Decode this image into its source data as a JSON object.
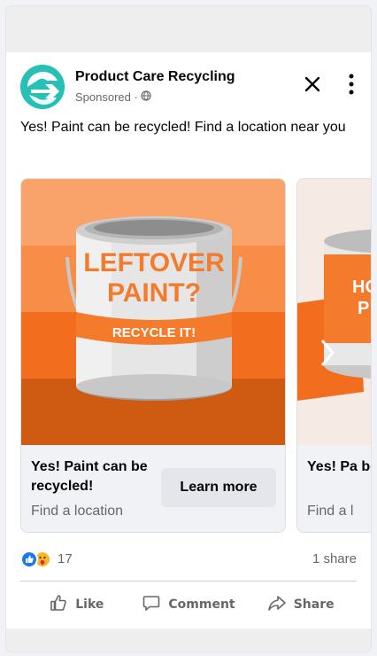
{
  "post": {
    "page_name": "Product Care Recycling",
    "sponsored_label": "Sponsored ·",
    "caption": "Yes! Paint can be recycled! Find a location near you"
  },
  "carousel": [
    {
      "image_text_1": "LEFTOVER",
      "image_text_2": "PAINT?",
      "image_text_3": "RECYCLE IT!",
      "title": "Yes! Paint can be recycled!",
      "subtitle": "Find a location",
      "cta": "Learn more"
    },
    {
      "image_text_1": "HO",
      "image_text_2": "P",
      "title": "Yes! Pa be recy",
      "subtitle": "Find a l"
    }
  ],
  "engagement": {
    "reaction_count": "17",
    "shares": "1 share"
  },
  "actions": {
    "like": "Like",
    "comment": "Comment",
    "share": "Share"
  },
  "colors": {
    "brand_teal": "#27c0b6",
    "orange_light": "#f7a26a",
    "orange_mid": "#f47a2c",
    "orange_dark": "#cf5a12",
    "like_blue": "#1877f2"
  },
  "icons": [
    "close-icon",
    "more-vertical-icon",
    "globe-icon",
    "like-reaction-icon",
    "care-reaction-icon",
    "thumbs-up-icon",
    "comment-icon",
    "share-icon"
  ]
}
